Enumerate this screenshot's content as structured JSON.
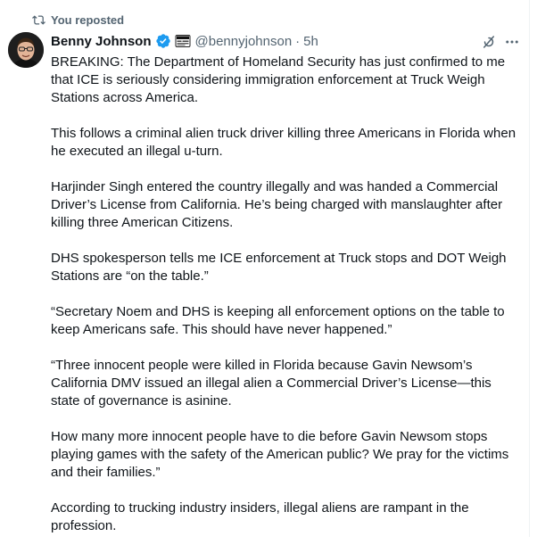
{
  "repost": {
    "label": "You reposted",
    "icon": "repost-icon"
  },
  "author": {
    "name": "Benny Johnson",
    "handle": "@bennyjohnson",
    "separator": "·",
    "time": "5h",
    "verified_color": "#1d9bf0",
    "verified_icon": "verified-badge-icon",
    "affiliate_icon": "affiliate-badge-icon"
  },
  "actions": {
    "grok_icon": "grok-icon",
    "more_icon": "more-options-icon"
  },
  "tweet": {
    "paragraphs": [
      "BREAKING: The Department of Homeland Security has just confirmed to me that ICE is seriously considering immigration enforcement at Truck Weigh Stations across America.",
      "This follows a criminal alien truck driver killing three Americans in Florida when he executed an illegal u-turn.",
      "Harjinder Singh entered the country illegally and was handed a Commercial Driver’s License from California. He’s being charged with manslaughter after killing three American Citizens.",
      "DHS spokesperson tells me ICE enforcement at Truck stops and DOT Weigh Stations are “on the table.”",
      "“Secretary Noem and DHS is keeping all enforcement options on the table to keep Americans safe. This should have never happened.”",
      "“Three innocent people were killed in Florida because Gavin Newsom’s California DMV issued an illegal alien a Commercial Driver’s License—this state of governance is asinine.",
      "How many more innocent people have to die before Gavin Newsom stops playing games with the safety of the American public? We pray for the victims and their families.”",
      "According to trucking industry insiders, illegal aliens are rampant in the profession."
    ]
  }
}
